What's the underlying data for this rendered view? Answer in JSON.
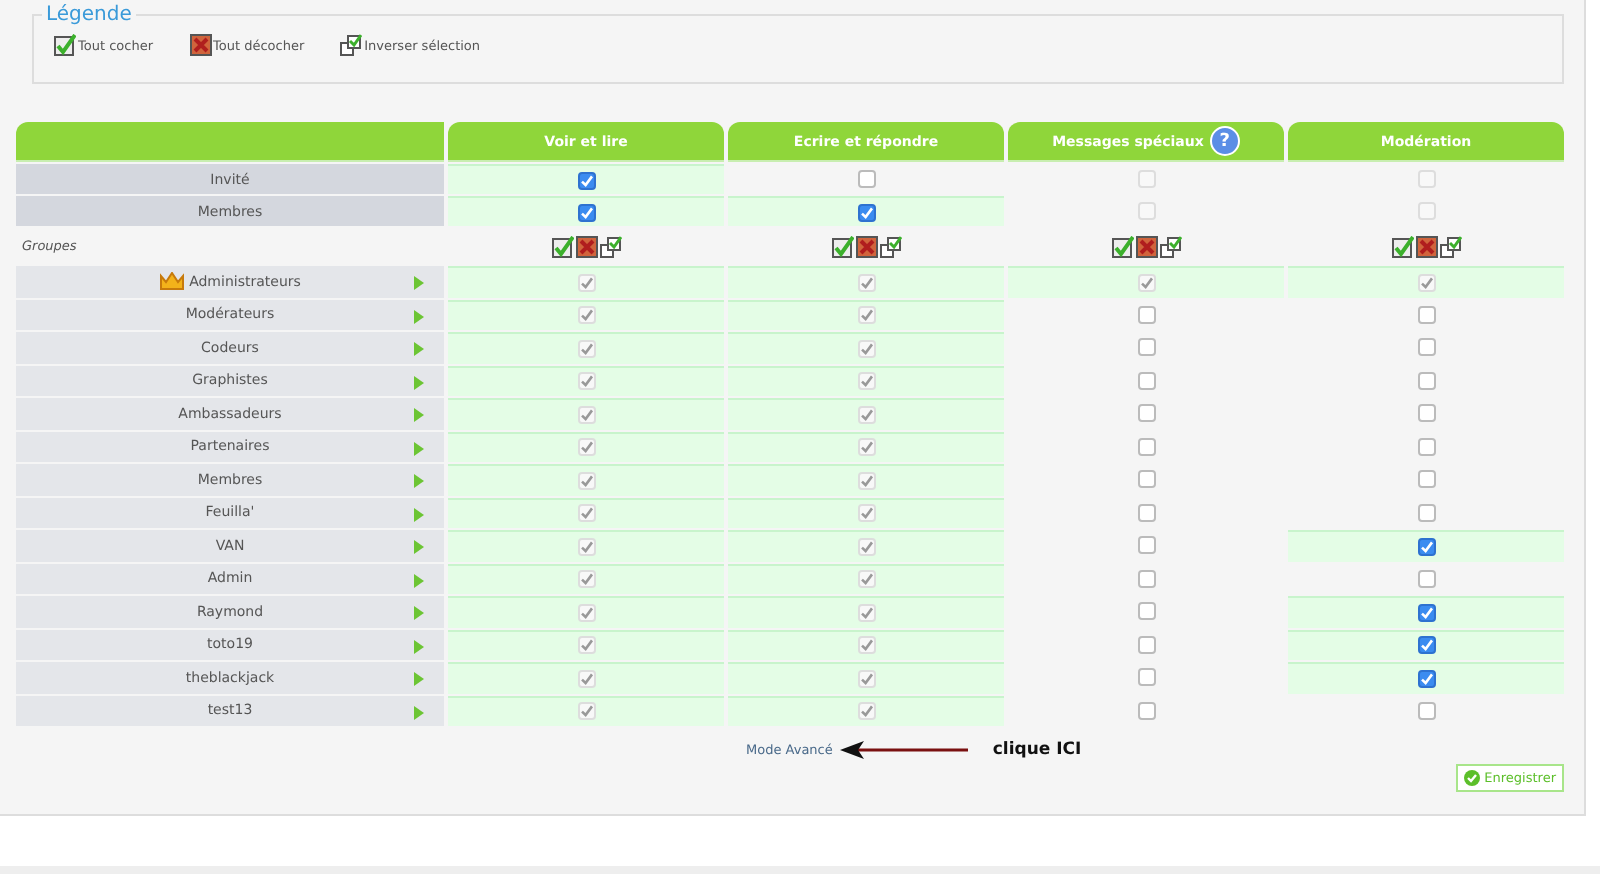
{
  "legend": {
    "title": "Légende",
    "items": [
      {
        "kind": "check_all",
        "label": "Tout cocher"
      },
      {
        "kind": "uncheck_all",
        "label": "Tout décocher"
      },
      {
        "kind": "invert",
        "label": "Inverser sélection"
      }
    ]
  },
  "table": {
    "columns": [
      {
        "label": "Voir et lire"
      },
      {
        "label": "Ecrire et répondre"
      },
      {
        "label": "Messages spéciaux",
        "help": "?"
      },
      {
        "label": "Modération"
      }
    ],
    "rows": [
      {
        "kind": "user",
        "label": "Invité",
        "cells": [
          {
            "checked": true,
            "disabled": false
          },
          {
            "checked": false,
            "disabled": false
          },
          {
            "checked": false,
            "disabled": true
          },
          {
            "checked": false,
            "disabled": true
          }
        ]
      },
      {
        "kind": "user",
        "label": "Membres",
        "cells": [
          {
            "checked": true,
            "disabled": false
          },
          {
            "checked": true,
            "disabled": false
          },
          {
            "checked": false,
            "disabled": true
          },
          {
            "checked": false,
            "disabled": true
          }
        ]
      },
      {
        "kind": "section",
        "label": "Groupes"
      },
      {
        "kind": "group",
        "label": "Administrateurs",
        "crown": true,
        "cells": [
          {
            "checked": true,
            "disabled": true
          },
          {
            "checked": true,
            "disabled": true
          },
          {
            "checked": true,
            "disabled": true
          },
          {
            "checked": true,
            "disabled": true
          }
        ]
      },
      {
        "kind": "group",
        "label": "Modérateurs",
        "crown": false,
        "cells": [
          {
            "checked": true,
            "disabled": true
          },
          {
            "checked": true,
            "disabled": true
          },
          {
            "checked": false,
            "disabled": false
          },
          {
            "checked": false,
            "disabled": false
          }
        ]
      },
      {
        "kind": "group",
        "label": "Codeurs",
        "crown": false,
        "cells": [
          {
            "checked": true,
            "disabled": true
          },
          {
            "checked": true,
            "disabled": true
          },
          {
            "checked": false,
            "disabled": false
          },
          {
            "checked": false,
            "disabled": false
          }
        ]
      },
      {
        "kind": "group",
        "label": "Graphistes",
        "crown": false,
        "cells": [
          {
            "checked": true,
            "disabled": true
          },
          {
            "checked": true,
            "disabled": true
          },
          {
            "checked": false,
            "disabled": false
          },
          {
            "checked": false,
            "disabled": false
          }
        ]
      },
      {
        "kind": "group",
        "label": "Ambassadeurs",
        "crown": false,
        "cells": [
          {
            "checked": true,
            "disabled": true
          },
          {
            "checked": true,
            "disabled": true
          },
          {
            "checked": false,
            "disabled": false
          },
          {
            "checked": false,
            "disabled": false
          }
        ]
      },
      {
        "kind": "group",
        "label": "Partenaires",
        "crown": false,
        "cells": [
          {
            "checked": true,
            "disabled": true
          },
          {
            "checked": true,
            "disabled": true
          },
          {
            "checked": false,
            "disabled": false
          },
          {
            "checked": false,
            "disabled": false
          }
        ]
      },
      {
        "kind": "group",
        "label": "Membres",
        "crown": false,
        "cells": [
          {
            "checked": true,
            "disabled": true
          },
          {
            "checked": true,
            "disabled": true
          },
          {
            "checked": false,
            "disabled": false
          },
          {
            "checked": false,
            "disabled": false
          }
        ]
      },
      {
        "kind": "group",
        "label": "Feuilla'",
        "crown": false,
        "cells": [
          {
            "checked": true,
            "disabled": true
          },
          {
            "checked": true,
            "disabled": true
          },
          {
            "checked": false,
            "disabled": false
          },
          {
            "checked": false,
            "disabled": false
          }
        ]
      },
      {
        "kind": "group",
        "label": "VAN",
        "crown": false,
        "cells": [
          {
            "checked": true,
            "disabled": true
          },
          {
            "checked": true,
            "disabled": true
          },
          {
            "checked": false,
            "disabled": false
          },
          {
            "checked": true,
            "disabled": false
          }
        ]
      },
      {
        "kind": "group",
        "label": "Admin",
        "crown": false,
        "cells": [
          {
            "checked": true,
            "disabled": true
          },
          {
            "checked": true,
            "disabled": true
          },
          {
            "checked": false,
            "disabled": false
          },
          {
            "checked": false,
            "disabled": false
          }
        ]
      },
      {
        "kind": "group",
        "label": "Raymond",
        "crown": false,
        "cells": [
          {
            "checked": true,
            "disabled": true
          },
          {
            "checked": true,
            "disabled": true
          },
          {
            "checked": false,
            "disabled": false
          },
          {
            "checked": true,
            "disabled": false
          }
        ]
      },
      {
        "kind": "group",
        "label": "toto19",
        "crown": false,
        "cells": [
          {
            "checked": true,
            "disabled": true
          },
          {
            "checked": true,
            "disabled": true
          },
          {
            "checked": false,
            "disabled": false
          },
          {
            "checked": true,
            "disabled": false
          }
        ]
      },
      {
        "kind": "group",
        "label": "theblackjack",
        "crown": false,
        "cells": [
          {
            "checked": true,
            "disabled": true
          },
          {
            "checked": true,
            "disabled": true
          },
          {
            "checked": false,
            "disabled": false
          },
          {
            "checked": true,
            "disabled": false
          }
        ]
      },
      {
        "kind": "group",
        "label": "test13",
        "crown": false,
        "cells": [
          {
            "checked": true,
            "disabled": true
          },
          {
            "checked": true,
            "disabled": true
          },
          {
            "checked": false,
            "disabled": false
          },
          {
            "checked": false,
            "disabled": false
          }
        ]
      }
    ]
  },
  "footer": {
    "advanced_link": "Mode Avancé",
    "annotation": "clique ICI",
    "save_button": "Enregistrer"
  }
}
